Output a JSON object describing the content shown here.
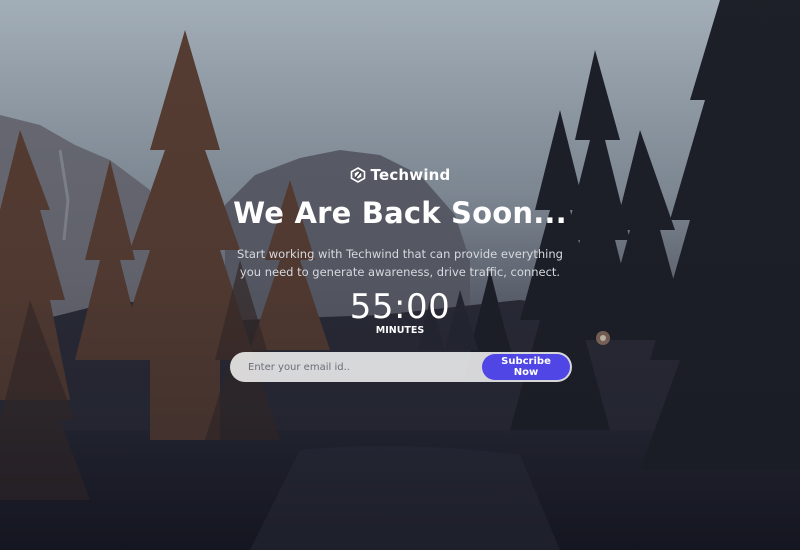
{
  "brand": {
    "name": "Techwind",
    "icon": "techwind-logo-icon"
  },
  "hero": {
    "title": "We Are Back Soon...",
    "subtitle": "Start working with Techwind that can provide everything you need to generate awareness, drive traffic, connect."
  },
  "countdown": {
    "time": "55:00",
    "label": "MINUTES"
  },
  "subscribe": {
    "placeholder": "Enter your email id..",
    "button_label": "Subcribe Now",
    "button_color": "#4f46e5"
  }
}
